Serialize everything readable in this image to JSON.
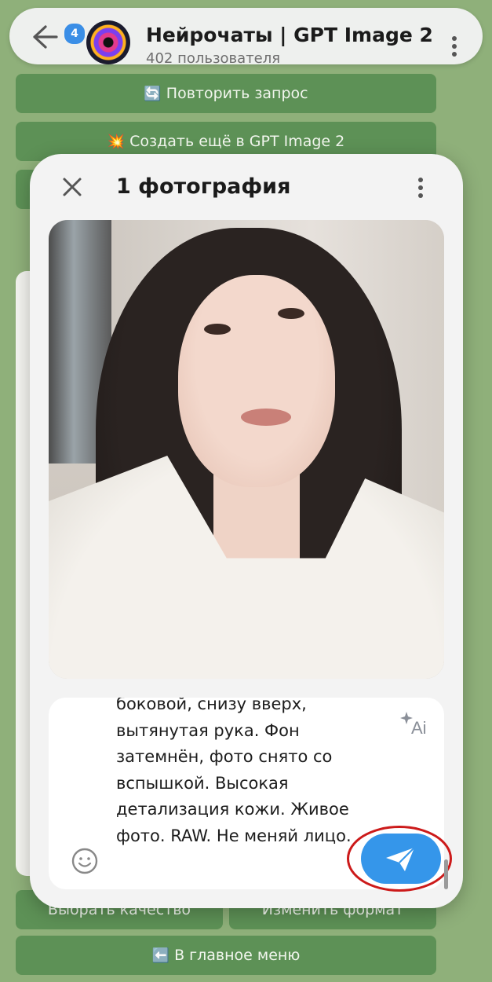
{
  "header": {
    "badge_count": "4",
    "title": "Нейрочаты | GPT Image 2 | ...",
    "subtitle": "402 пользователя"
  },
  "bot_buttons": {
    "repeat": {
      "emoji": "🔄",
      "label": "Повторить запрос"
    },
    "create_more": {
      "emoji": "💥",
      "label": "Создать ещё в GPT Image 2"
    },
    "choose_quality": {
      "label": "Выбрать качество"
    },
    "change_format": {
      "label": "Изменить формат"
    },
    "main_menu": {
      "emoji": "⬅️",
      "label": "В главное меню"
    }
  },
  "modal": {
    "title": "1 фотография",
    "caption": "боковой, снизу вверх, вытянутая рука. Фон затемнён, фото снято со вспышкой. Высокая детализация кожи. Живое фото. RAW. Не меняй лицо.",
    "ai_label": "Ai"
  },
  "colors": {
    "send_button": "#3596ea",
    "highlight_ring": "#cc1a1a",
    "chat_background": "#8fb07a",
    "bot_button": "#558c50"
  }
}
